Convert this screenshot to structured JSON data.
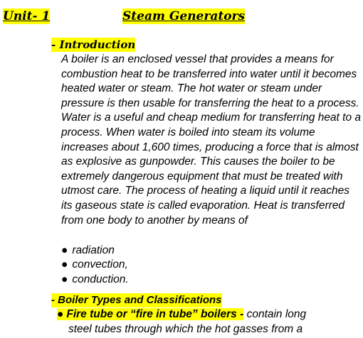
{
  "header": {
    "unit_label": "Unit- 1",
    "title": "Steam Generators"
  },
  "intro": {
    "heading": "- Introduction",
    "paragraph": "A boiler is an enclosed vessel that provides a means for combustion heat to be transferred into water until it becomes heated water or steam. The hot water or steam under pressure is then usable for transferring the heat to a process. Water is a useful and cheap medium for transferring heat to a process. When water is boiled into steam its volume increases about 1,600 times, producing a force that is almost as explosive as gunpowder. This causes the boiler to be extremely dangerous equipment that must be treated with utmost care. The process of heating a liquid until it reaches its gaseous state is called evaporation. Heat is transferred from one body to another by means of",
    "bullets": [
      "radiation",
      "convection,",
      "conduction."
    ]
  },
  "types": {
    "heading": "- Boiler Types and Classifications",
    "first_item_lead": "Fire tube or “fire in tube” boilers -",
    "first_item_text_line1": " contain long",
    "first_item_text_line2": "steel tubes through which the hot gasses from a"
  },
  "colors": {
    "highlight": "#ffff00",
    "text": "#000000"
  }
}
